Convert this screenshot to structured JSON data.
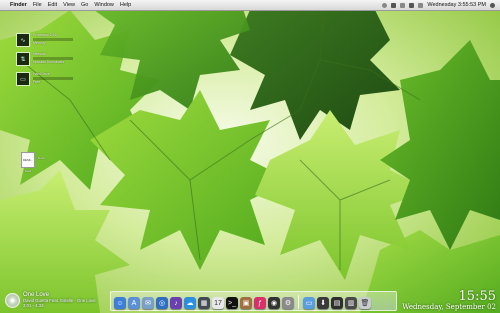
{
  "menubar": {
    "apple_glyph": "",
    "app_name": "Finder",
    "menus": [
      "File",
      "Edit",
      "View",
      "Go",
      "Window",
      "Help"
    ],
    "clock": "Wednesday 3:55:53 PM",
    "status_icons": [
      "bluetooth-icon",
      "time-machine-icon",
      "wifi-icon",
      "volume-icon",
      "battery-icon",
      "user-icon",
      "spotlight-icon"
    ]
  },
  "widgets": [
    {
      "icon": "activity-icon",
      "line1": "Processor 2.46",
      "line2": "Memory"
    },
    {
      "icon": "network-icon",
      "line1": "Network",
      "line2": "Uploads Downloads"
    },
    {
      "icon": "disk-icon",
      "line1": "Hard Drive",
      "line2": "Free"
    }
  ],
  "desktop_icons": [
    {
      "label": "DESK...",
      "name": "Desk"
    },
    {
      "label": "Docs",
      "name": "Docs"
    }
  ],
  "now_playing": {
    "title": "One Love",
    "subtitle": "David Guetta Feat. Estelle - One Love",
    "time": "3:01 - 4:33"
  },
  "clock": {
    "time": "15:55",
    "date": "Wednesday, September 02"
  },
  "dock": {
    "items": [
      {
        "name": "finder-icon",
        "color": "#3d7fd8",
        "glyph": "☺"
      },
      {
        "name": "app-store-icon",
        "color": "#5b8fd6",
        "glyph": "A"
      },
      {
        "name": "mail-icon",
        "color": "#7aa0c8",
        "glyph": "✉"
      },
      {
        "name": "safari-icon",
        "color": "#2f6ec0",
        "glyph": "◎"
      },
      {
        "name": "itunes-icon",
        "color": "#6a3fb0",
        "glyph": "♪"
      },
      {
        "name": "ichat-icon",
        "color": "#2d8fe0",
        "glyph": "☁"
      },
      {
        "name": "preview-icon",
        "color": "#444a52",
        "glyph": "▦"
      },
      {
        "name": "calendar-icon",
        "color": "#e8e8e8",
        "glyph": "17"
      },
      {
        "name": "terminal-icon",
        "color": "#111111",
        "glyph": ">_"
      },
      {
        "name": "photo-icon",
        "color": "#a07040",
        "glyph": "▣"
      },
      {
        "name": "flash-icon",
        "color": "#d8306a",
        "glyph": "ƒ"
      },
      {
        "name": "dashboard-icon",
        "color": "#333333",
        "glyph": "◉"
      },
      {
        "name": "preferences-icon",
        "color": "#8a8a8a",
        "glyph": "⚙"
      },
      {
        "name": "folder-icon",
        "color": "#5a9ee0",
        "glyph": "▭"
      },
      {
        "name": "downloads-icon",
        "color": "#3a3a3a",
        "glyph": "⬇"
      },
      {
        "name": "applications-icon",
        "color": "#2e2e2e",
        "glyph": "▤"
      },
      {
        "name": "stack-icon",
        "color": "#4a4a4a",
        "glyph": "▥"
      },
      {
        "name": "trash-icon",
        "color": "#c8ccd0",
        "glyph": "🗑"
      }
    ]
  }
}
